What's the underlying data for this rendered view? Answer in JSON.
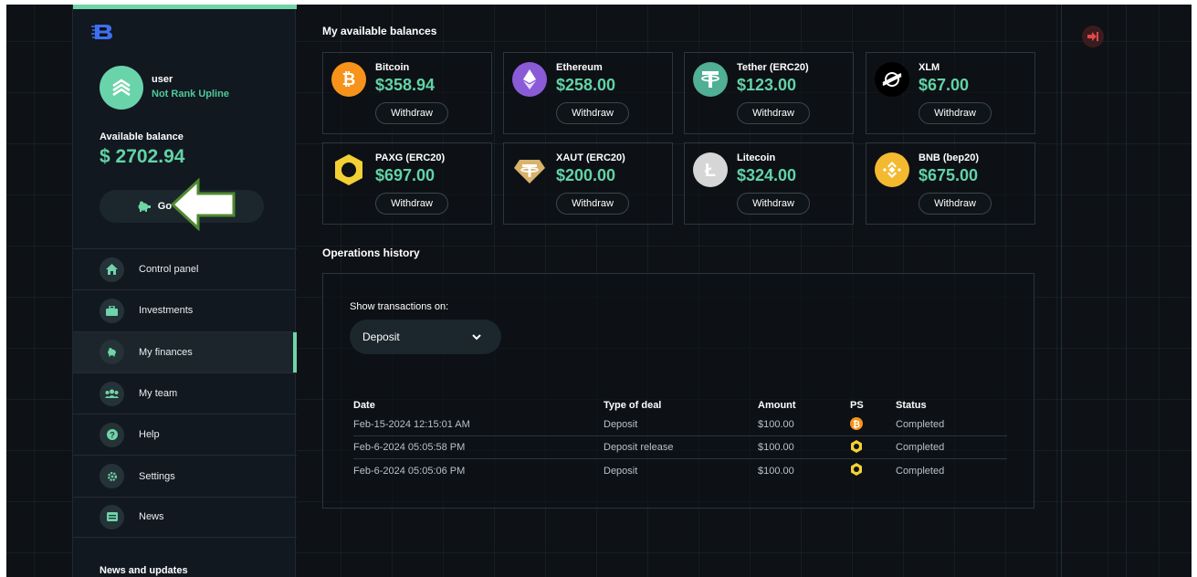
{
  "sidebar": {
    "user": {
      "name": "user",
      "rank": "Not Rank Upline"
    },
    "balance": {
      "label": "Available balance",
      "value": "$ 2702.94"
    },
    "bank_button": "Go to my bank",
    "nav": [
      {
        "label": "Control panel",
        "icon": "home-icon"
      },
      {
        "label": "Investments",
        "icon": "briefcase-icon"
      },
      {
        "label": "My finances",
        "icon": "piggy-bank-icon",
        "active": true
      },
      {
        "label": "My team",
        "icon": "users-icon"
      },
      {
        "label": "Help",
        "icon": "question-icon"
      },
      {
        "label": "Settings",
        "icon": "gear-icon"
      },
      {
        "label": "News",
        "icon": "news-icon"
      }
    ],
    "news_updates": "News and updates"
  },
  "balances": {
    "title": "My available balances",
    "withdraw_label": "Withdraw",
    "cards": [
      {
        "name": "Bitcoin",
        "value": "$358.94",
        "icon": "bitcoin-icon",
        "color": "#f7931a"
      },
      {
        "name": "Ethereum",
        "value": "$258.00",
        "icon": "ethereum-icon",
        "color": "#8a5bd6"
      },
      {
        "name": "Tether (ERC20)",
        "value": "$123.00",
        "icon": "tether-icon",
        "color": "#50af95"
      },
      {
        "name": "XLM",
        "value": "$67.00",
        "icon": "stellar-icon",
        "color": "#000000"
      },
      {
        "name": "PAXG (ERC20)",
        "value": "$697.00",
        "icon": "paxg-icon",
        "color": "#e4ce4b"
      },
      {
        "name": "XAUT (ERC20)",
        "value": "$200.00",
        "icon": "xaut-icon",
        "color": "#d0a857"
      },
      {
        "name": "Litecoin",
        "value": "$324.00",
        "icon": "litecoin-icon",
        "color": "#d6d6d6"
      },
      {
        "name": "BNB (bep20)",
        "value": "$675.00",
        "icon": "bnb-icon",
        "color": "#f3ba2f"
      }
    ]
  },
  "history": {
    "title": "Operations history",
    "show_label": "Show transactions on:",
    "selected": "Deposit",
    "columns": [
      "Date",
      "Type of deal",
      "Amount",
      "PS",
      "Status"
    ],
    "rows": [
      {
        "date": "Feb-15-2024 12:15:01 AM",
        "type": "Deposit",
        "amount": "$100.00",
        "ps": "bitcoin-icon",
        "status": "Completed"
      },
      {
        "date": "Feb-6-2024 05:05:58 PM",
        "type": "Deposit release",
        "amount": "$100.00",
        "ps": "paxg-icon",
        "status": "Completed"
      },
      {
        "date": "Feb-6-2024 05:05:06 PM",
        "type": "Deposit",
        "amount": "$100.00",
        "ps": "paxg-icon",
        "status": "Completed"
      }
    ]
  },
  "colors": {
    "accent": "#62d3a6",
    "background": "#0e1116",
    "logout": "#e04848"
  }
}
